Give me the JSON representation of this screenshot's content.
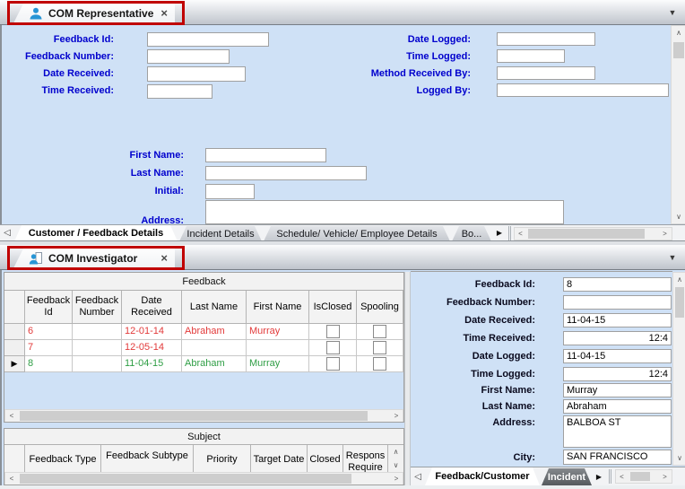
{
  "icons": {
    "close": "×",
    "dropdown": "▼",
    "tab_prev": "◁",
    "tab_next": "▶",
    "scroll_up": "∧",
    "scroll_down": "∨",
    "scroll_left": "<",
    "scroll_right": ">",
    "row_marker": "▶",
    "representative_tab_icon": "person",
    "investigator_tab_icon": "person-with-document"
  },
  "colors": {
    "panel_background": "#cfe1f6",
    "label_blue": "#0000cd",
    "row_red": "#e23a3a",
    "row_green": "#2f9e45",
    "annotation_red": "#c00000"
  },
  "top_panel": {
    "tab_title": "COM Representative",
    "fields_left": [
      {
        "label": "Feedback Id:",
        "value": ""
      },
      {
        "label": "Feedback Number:",
        "value": ""
      },
      {
        "label": "Date Received:",
        "value": ""
      },
      {
        "label": "Time Received:",
        "value": ""
      }
    ],
    "fields_right": [
      {
        "label": "Date Logged:",
        "value": ""
      },
      {
        "label": "Time Logged:",
        "value": ""
      },
      {
        "label": "Method Received By:",
        "value": ""
      },
      {
        "label": "Logged By:",
        "value": ""
      }
    ],
    "fields_customer": [
      {
        "label": "First Name:",
        "value": ""
      },
      {
        "label": "Last Name:",
        "value": ""
      },
      {
        "label": "Initial:",
        "value": ""
      },
      {
        "label": "Address:",
        "value": ""
      }
    ],
    "bottom_tabs": [
      {
        "label": "Customer / Feedback Details",
        "active": true
      },
      {
        "label": "Incident Details",
        "active": false
      },
      {
        "label": "Schedule/ Vehicle/ Employee Details",
        "active": false
      },
      {
        "label": "Bo...",
        "active": false
      }
    ]
  },
  "bottom_panel": {
    "tab_title": "COM Investigator",
    "feedback_grid": {
      "group_title": "Feedback",
      "columns": [
        "Feedback Id",
        "Feedback Number",
        "Date Received",
        "Last Name",
        "First Name",
        "IsClosed",
        "Spooling"
      ],
      "rows": [
        {
          "feedback_id": "6",
          "feedback_number": "",
          "date_received": "12-01-14",
          "last_name": "Abraham",
          "first_name": "Murray",
          "is_closed": false,
          "spooling": false,
          "state": "red",
          "selected": false
        },
        {
          "feedback_id": "7",
          "feedback_number": "",
          "date_received": "12-05-14",
          "last_name": "",
          "first_name": "",
          "is_closed": false,
          "spooling": false,
          "state": "red",
          "selected": false
        },
        {
          "feedback_id": "8",
          "feedback_number": "",
          "date_received": "11-04-15",
          "last_name": "Abraham",
          "first_name": "Murray",
          "is_closed": false,
          "spooling": false,
          "state": "green",
          "selected": true
        }
      ]
    },
    "subject_grid": {
      "group_title": "Subject",
      "columns": [
        "Feedback Type",
        "Feedback Subtype",
        "Priority",
        "Target Date",
        "Closed",
        "Respons Require"
      ]
    },
    "detail_fields": [
      {
        "label": "Feedback Id:",
        "value": "8"
      },
      {
        "label": "Feedback Number:",
        "value": ""
      },
      {
        "label": "Date Received:",
        "value": "11-04-15"
      },
      {
        "label": "Time Received:",
        "value": "12:4"
      },
      {
        "label": "Date Logged:",
        "value": "11-04-15"
      },
      {
        "label": "Time Logged:",
        "value": "12:4"
      },
      {
        "label": "First Name:",
        "value": "Murray"
      },
      {
        "label": "Last Name:",
        "value": "Abraham"
      },
      {
        "label": "Address:",
        "value": "BALBOA ST"
      },
      {
        "label": "City:",
        "value": "SAN FRANCISCO"
      }
    ],
    "bottom_tabs": [
      {
        "label": "Feedback/Customer",
        "active": true
      },
      {
        "label": "Incident",
        "active": false
      }
    ]
  }
}
